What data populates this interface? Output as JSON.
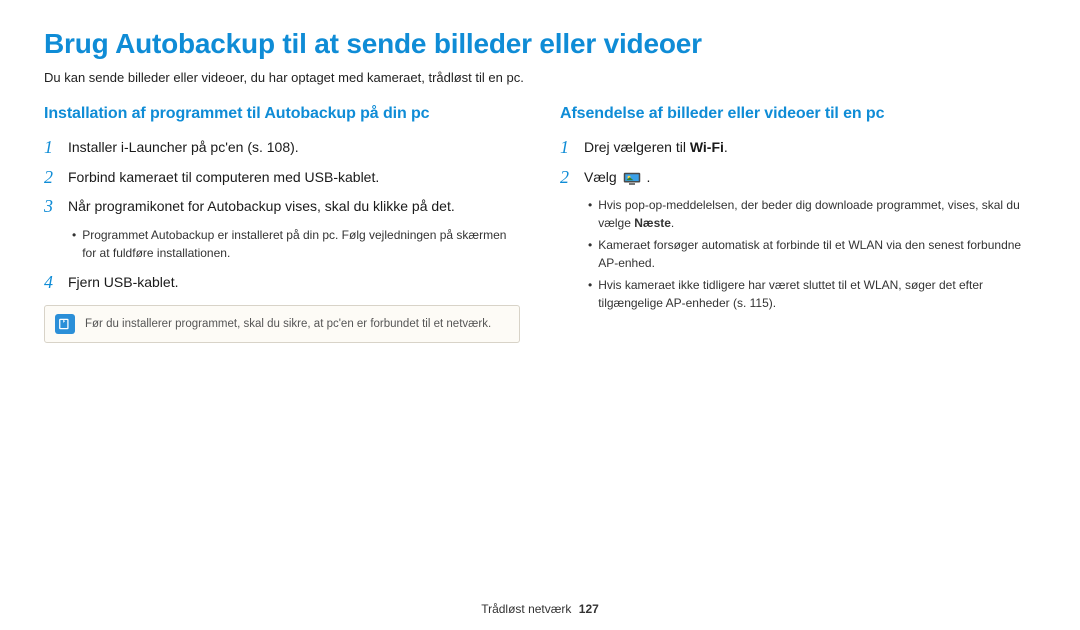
{
  "title": "Brug Autobackup til at sende billeder eller videoer",
  "intro": "Du kan sende billeder eller videoer, du har optaget med kameraet, trådløst til en pc.",
  "left": {
    "heading": "Installation af programmet til Autobackup på din pc",
    "steps": [
      {
        "n": "1",
        "text": "Installer i-Launcher på pc'en (s. 108)."
      },
      {
        "n": "2",
        "text": "Forbind kameraet til computeren med USB-kablet."
      },
      {
        "n": "3",
        "text": "Når programikonet for Autobackup vises, skal du klikke på det."
      },
      {
        "n": "4",
        "text": "Fjern USB-kablet."
      }
    ],
    "sub_after_3": [
      "Programmet Autobackup er installeret på din pc. Følg vejledningen på skærmen for at fuldføre installationen."
    ],
    "note": "Før du installerer programmet, skal du sikre, at pc'en er forbundet til et netværk."
  },
  "right": {
    "heading": "Afsendelse af billeder eller videoer til en pc",
    "step1_prefix": "Drej vælgeren til ",
    "step1_wifi": "Wi-Fi",
    "step1_suffix": ".",
    "step2_prefix": "Vælg ",
    "step2_suffix": ".",
    "step_nums": {
      "one": "1",
      "two": "2"
    },
    "subs": [
      {
        "pre": "Hvis pop-op-meddelelsen, der beder dig downloade programmet, vises, skal du vælge ",
        "bold": "Næste",
        "post": "."
      },
      {
        "pre": "Kameraet forsøger automatisk at forbinde til et WLAN via den senest forbundne AP-enhed.",
        "bold": "",
        "post": ""
      },
      {
        "pre": "Hvis kameraet ikke tidligere har været sluttet til et WLAN, søger det efter tilgængelige AP-enheder (s. 115).",
        "bold": "",
        "post": ""
      }
    ]
  },
  "footer": {
    "label": "Trådløst netværk",
    "page": "127"
  }
}
